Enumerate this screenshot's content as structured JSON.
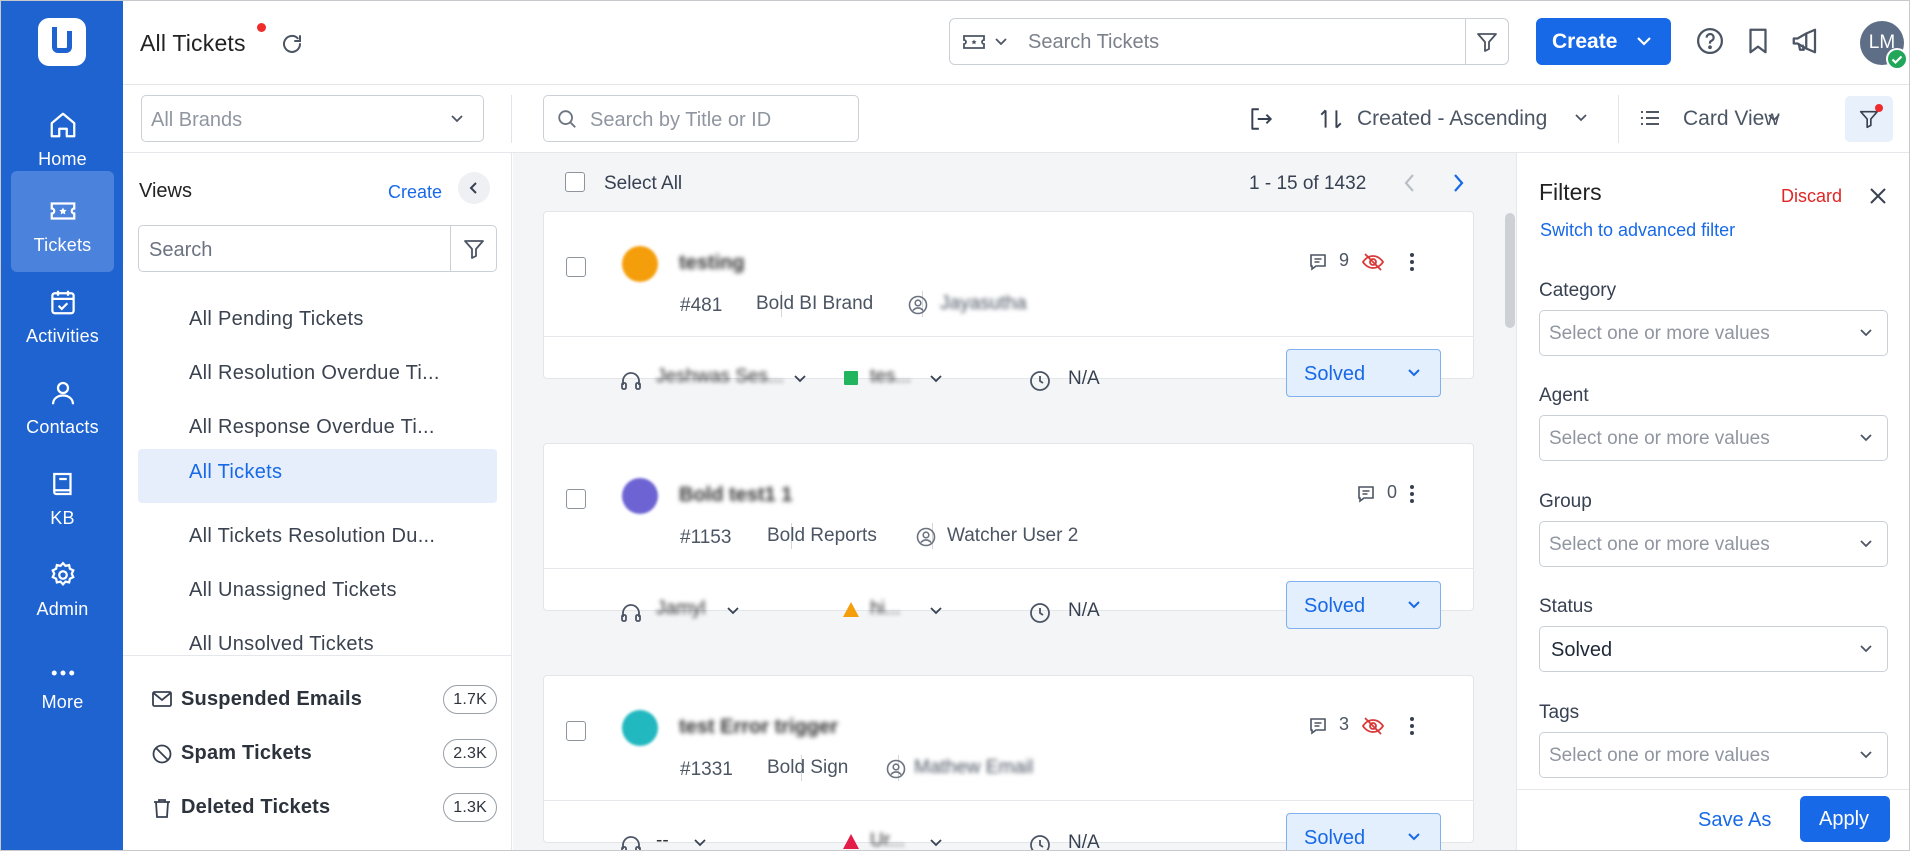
{
  "nav": {
    "items": [
      {
        "label": "Home",
        "icon": "home-icon"
      },
      {
        "label": "Tickets",
        "icon": "ticket-icon",
        "active": true
      },
      {
        "label": "Activities",
        "icon": "calendar-check-icon"
      },
      {
        "label": "Contacts",
        "icon": "person-icon"
      },
      {
        "label": "KB",
        "icon": "book-icon"
      },
      {
        "label": "Admin",
        "icon": "gear-icon"
      },
      {
        "label": "More",
        "icon": "more-dots-icon"
      }
    ]
  },
  "header": {
    "title": "All Tickets",
    "search_placeholder": "Search Tickets",
    "create_label": "Create",
    "avatar_initials": "LM"
  },
  "toolbar": {
    "brand_placeholder": "All Brands",
    "title_search_placeholder": "Search by Title or ID",
    "sort_label": "Created - Ascending",
    "view_label": "Card View"
  },
  "views": {
    "title": "Views",
    "create_link": "Create",
    "search_placeholder": "Search",
    "items": [
      {
        "label": "All Pending Tickets"
      },
      {
        "label": "All Resolution Overdue Ti..."
      },
      {
        "label": "All Response Overdue Ti..."
      },
      {
        "label": "All Tickets",
        "active": true
      },
      {
        "label": "All Tickets Resolution Du..."
      },
      {
        "label": "All Unassigned Tickets"
      },
      {
        "label": "All Unsolved Tickets"
      }
    ],
    "system": [
      {
        "label": "Suspended Emails",
        "count": "1.7K",
        "icon": "mail-icon"
      },
      {
        "label": "Spam Tickets",
        "count": "2.3K",
        "icon": "ban-icon"
      },
      {
        "label": "Deleted Tickets",
        "count": "1.3K",
        "icon": "trash-icon"
      }
    ]
  },
  "list": {
    "select_all_label": "Select All",
    "pager": "1 - 15 of 1432",
    "tickets": [
      {
        "subject": "testing",
        "id": "#481",
        "brand": "Bold BI Brand",
        "user": "Jayasutha",
        "comments": "9",
        "hidden": true,
        "agent": "Jeshwas Ses...",
        "priority_label": "tes...",
        "priority_color": "#22b55e",
        "due": "N/A",
        "status": "Solved",
        "avatar_color": "#f59e0b"
      },
      {
        "subject": "Bold test1 1",
        "id": "#1153",
        "brand": "Bold Reports",
        "user": "Watcher User 2",
        "comments": "0",
        "hidden": false,
        "agent": "Jamyl",
        "priority_label": "hi...",
        "priority_color": "#f59e0b",
        "due": "N/A",
        "status": "Solved",
        "avatar_color": "#6d63d3"
      },
      {
        "subject": "test Error trigger",
        "id": "#1331",
        "brand": "Bold Sign",
        "user": "Mathew Email",
        "comments": "3",
        "hidden": true,
        "agent": "--",
        "priority_label": "Ur...",
        "priority_color": "#e11d48",
        "due": "N/A",
        "status": "Solved",
        "avatar_color": "#22b8c0"
      }
    ]
  },
  "filters": {
    "title": "Filters",
    "discard": "Discard",
    "advanced_link": "Switch to advanced filter",
    "fields": [
      {
        "label": "Category",
        "value": "",
        "placeholder": "Select one or more values"
      },
      {
        "label": "Agent",
        "value": "",
        "placeholder": "Select one or more values"
      },
      {
        "label": "Group",
        "value": "",
        "placeholder": "Select one or more values"
      },
      {
        "label": "Status",
        "value": "Solved",
        "placeholder": "Select one or more values"
      },
      {
        "label": "Tags",
        "value": "",
        "placeholder": "Select one or more values"
      }
    ],
    "save_as": "Save As",
    "apply": "Apply"
  }
}
